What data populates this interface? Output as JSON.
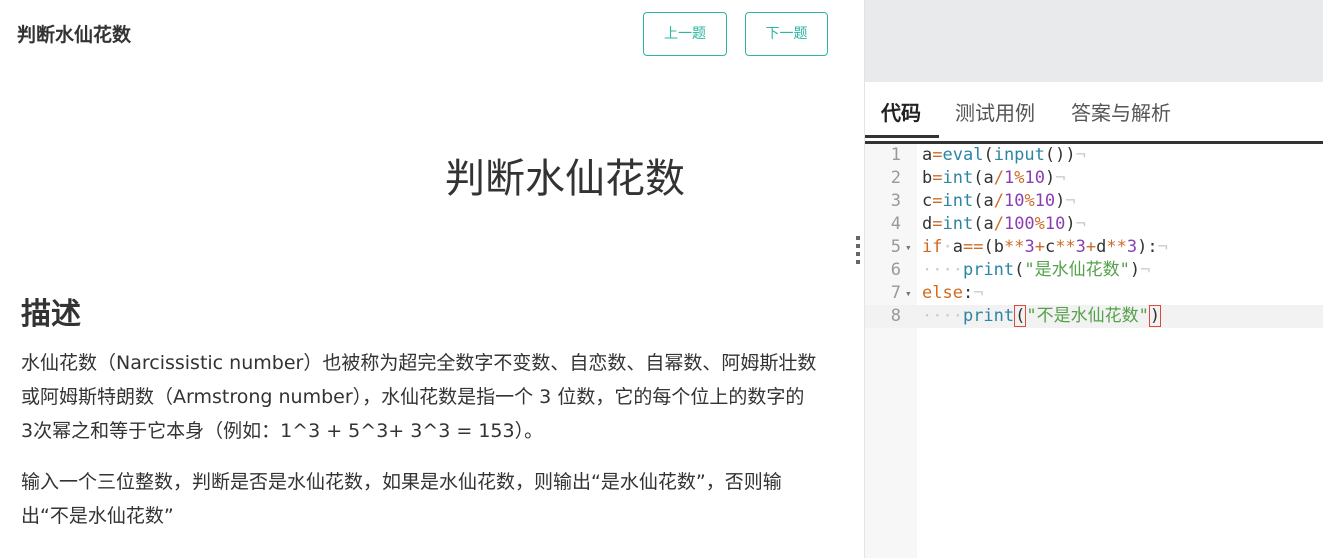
{
  "header": {
    "title": "判断水仙花数",
    "prev_label": "上一题",
    "next_label": "下一题"
  },
  "problem": {
    "title": "判断水仙花数",
    "section_heading": "描述",
    "paragraphs": [
      "水仙花数（Narcissistic number）也被称为超完全数字不变数、自恋数、自幂数、阿姆斯壮数或阿姆斯特朗数（Armstrong number），水仙花数是指一个 3 位数，它的每个位上的数字的 3次幂之和等于它本身（例如：1^3 + 5^3+ 3^3 = 153）。",
      "输入一个三位整数，判断是否是水仙花数，如果是水仙花数，则输出“是水仙花数”，否则输出“不是水仙花数”"
    ]
  },
  "tabs": [
    {
      "label": "代码",
      "active": true
    },
    {
      "label": "测试用例",
      "active": false
    },
    {
      "label": "答案与解析",
      "active": false
    }
  ],
  "editor": {
    "active_line": 8,
    "lines": [
      {
        "num": "1",
        "fold": false,
        "tokens": [
          [
            "t",
            "a"
          ],
          [
            "o",
            "="
          ],
          [
            "f",
            "eval"
          ],
          [
            "t",
            "("
          ],
          [
            "f",
            "input"
          ],
          [
            "t",
            "())"
          ],
          [
            "i",
            "¬"
          ]
        ]
      },
      {
        "num": "2",
        "fold": false,
        "tokens": [
          [
            "t",
            "b"
          ],
          [
            "o",
            "="
          ],
          [
            "f",
            "int"
          ],
          [
            "t",
            "(a"
          ],
          [
            "o",
            "/"
          ],
          [
            "n",
            "1"
          ],
          [
            "o",
            "%"
          ],
          [
            "n",
            "10"
          ],
          [
            "t",
            ")"
          ],
          [
            "i",
            "¬"
          ]
        ]
      },
      {
        "num": "3",
        "fold": false,
        "tokens": [
          [
            "t",
            "c"
          ],
          [
            "o",
            "="
          ],
          [
            "f",
            "int"
          ],
          [
            "t",
            "(a"
          ],
          [
            "o",
            "/"
          ],
          [
            "n",
            "10"
          ],
          [
            "o",
            "%"
          ],
          [
            "n",
            "10"
          ],
          [
            "t",
            ")"
          ],
          [
            "i",
            "¬"
          ]
        ]
      },
      {
        "num": "4",
        "fold": false,
        "tokens": [
          [
            "t",
            "d"
          ],
          [
            "o",
            "="
          ],
          [
            "f",
            "int"
          ],
          [
            "t",
            "(a"
          ],
          [
            "o",
            "/"
          ],
          [
            "n",
            "100"
          ],
          [
            "o",
            "%"
          ],
          [
            "n",
            "10"
          ],
          [
            "t",
            ")"
          ],
          [
            "i",
            "¬"
          ]
        ]
      },
      {
        "num": "5",
        "fold": true,
        "tokens": [
          [
            "k",
            "if"
          ],
          [
            "i",
            "·"
          ],
          [
            "t",
            "a"
          ],
          [
            "o",
            "=="
          ],
          [
            "t",
            "(b"
          ],
          [
            "o",
            "**"
          ],
          [
            "n",
            "3"
          ],
          [
            "o",
            "+"
          ],
          [
            "t",
            "c"
          ],
          [
            "o",
            "**"
          ],
          [
            "n",
            "3"
          ],
          [
            "o",
            "+"
          ],
          [
            "t",
            "d"
          ],
          [
            "o",
            "**"
          ],
          [
            "n",
            "3"
          ],
          [
            "t",
            "):"
          ],
          [
            "i",
            "¬"
          ]
        ]
      },
      {
        "num": "6",
        "fold": false,
        "tokens": [
          [
            "i",
            "····"
          ],
          [
            "f",
            "print"
          ],
          [
            "t",
            "("
          ],
          [
            "s",
            "\"是水仙花数\""
          ],
          [
            "t",
            ")"
          ],
          [
            "i",
            "¬"
          ]
        ]
      },
      {
        "num": "7",
        "fold": true,
        "tokens": [
          [
            "k",
            "else"
          ],
          [
            "t",
            ":"
          ],
          [
            "i",
            "¬"
          ]
        ]
      },
      {
        "num": "8",
        "fold": false,
        "tokens": [
          [
            "i",
            "····"
          ],
          [
            "f",
            "print"
          ],
          [
            "b",
            "("
          ],
          [
            "s",
            "\"不是水仙花数\""
          ],
          [
            "b",
            ")"
          ]
        ]
      }
    ]
  },
  "icons": {
    "fold": "fold-arrow-icon",
    "splitter": "drag-handle-icon"
  }
}
